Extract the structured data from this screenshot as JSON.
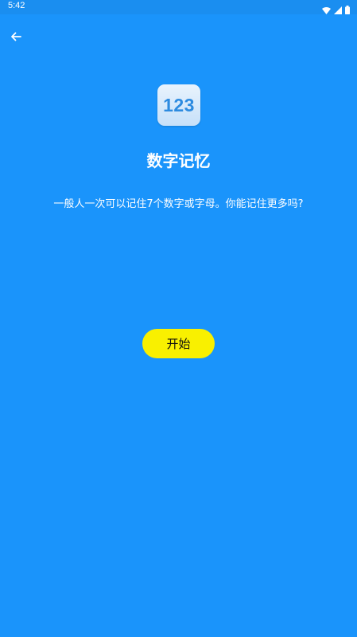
{
  "status_bar": {
    "time": "5:42",
    "icons": [
      "wifi-icon",
      "signal-icon",
      "battery-icon"
    ]
  },
  "nav": {
    "back_icon": "arrow-left-icon"
  },
  "logo": {
    "text": "123"
  },
  "title": "数字记忆",
  "description": "一般人一次可以记住7个数字或字母。你能记住更多吗?",
  "start_button": {
    "label": "开始"
  },
  "colors": {
    "background": "#1a94fb",
    "button": "#f9f000",
    "logo_text": "#2d8be0"
  }
}
